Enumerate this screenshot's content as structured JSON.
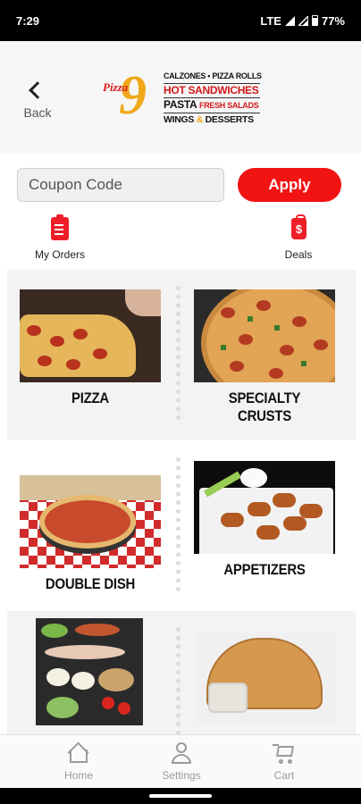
{
  "status_bar": {
    "time": "7:29",
    "network": "LTE",
    "battery": "77%"
  },
  "header": {
    "back_label": "Back",
    "logo": {
      "brand_small": "Pizza",
      "brand_number": "9",
      "line1": "CALZONES • PIZZA ROLLS",
      "line2": "HOT SANDWICHES",
      "line3_a": "PASTA",
      "line3_b": "FRESH SALADS",
      "line4_a": "WINGS",
      "line4_amp": "&",
      "line4_b": "DESSERTS"
    }
  },
  "coupon": {
    "placeholder": "Coupon Code",
    "apply_label": "Apply"
  },
  "quick_actions": {
    "orders_label": "My Orders",
    "deals_label": "Deals",
    "deals_glyph": "$"
  },
  "categories": [
    {
      "label": "PIZZA"
    },
    {
      "label": "SPECIALTY CRUSTS"
    },
    {
      "label": "DOUBLE DISH"
    },
    {
      "label": "APPETIZERS"
    }
  ],
  "bottom_nav": {
    "home": "Home",
    "settings": "Settings",
    "cart": "Cart"
  },
  "colors": {
    "accent": "#f21313",
    "brand_gold": "#f0a81a",
    "tile_bg": "#f3f3f3"
  }
}
